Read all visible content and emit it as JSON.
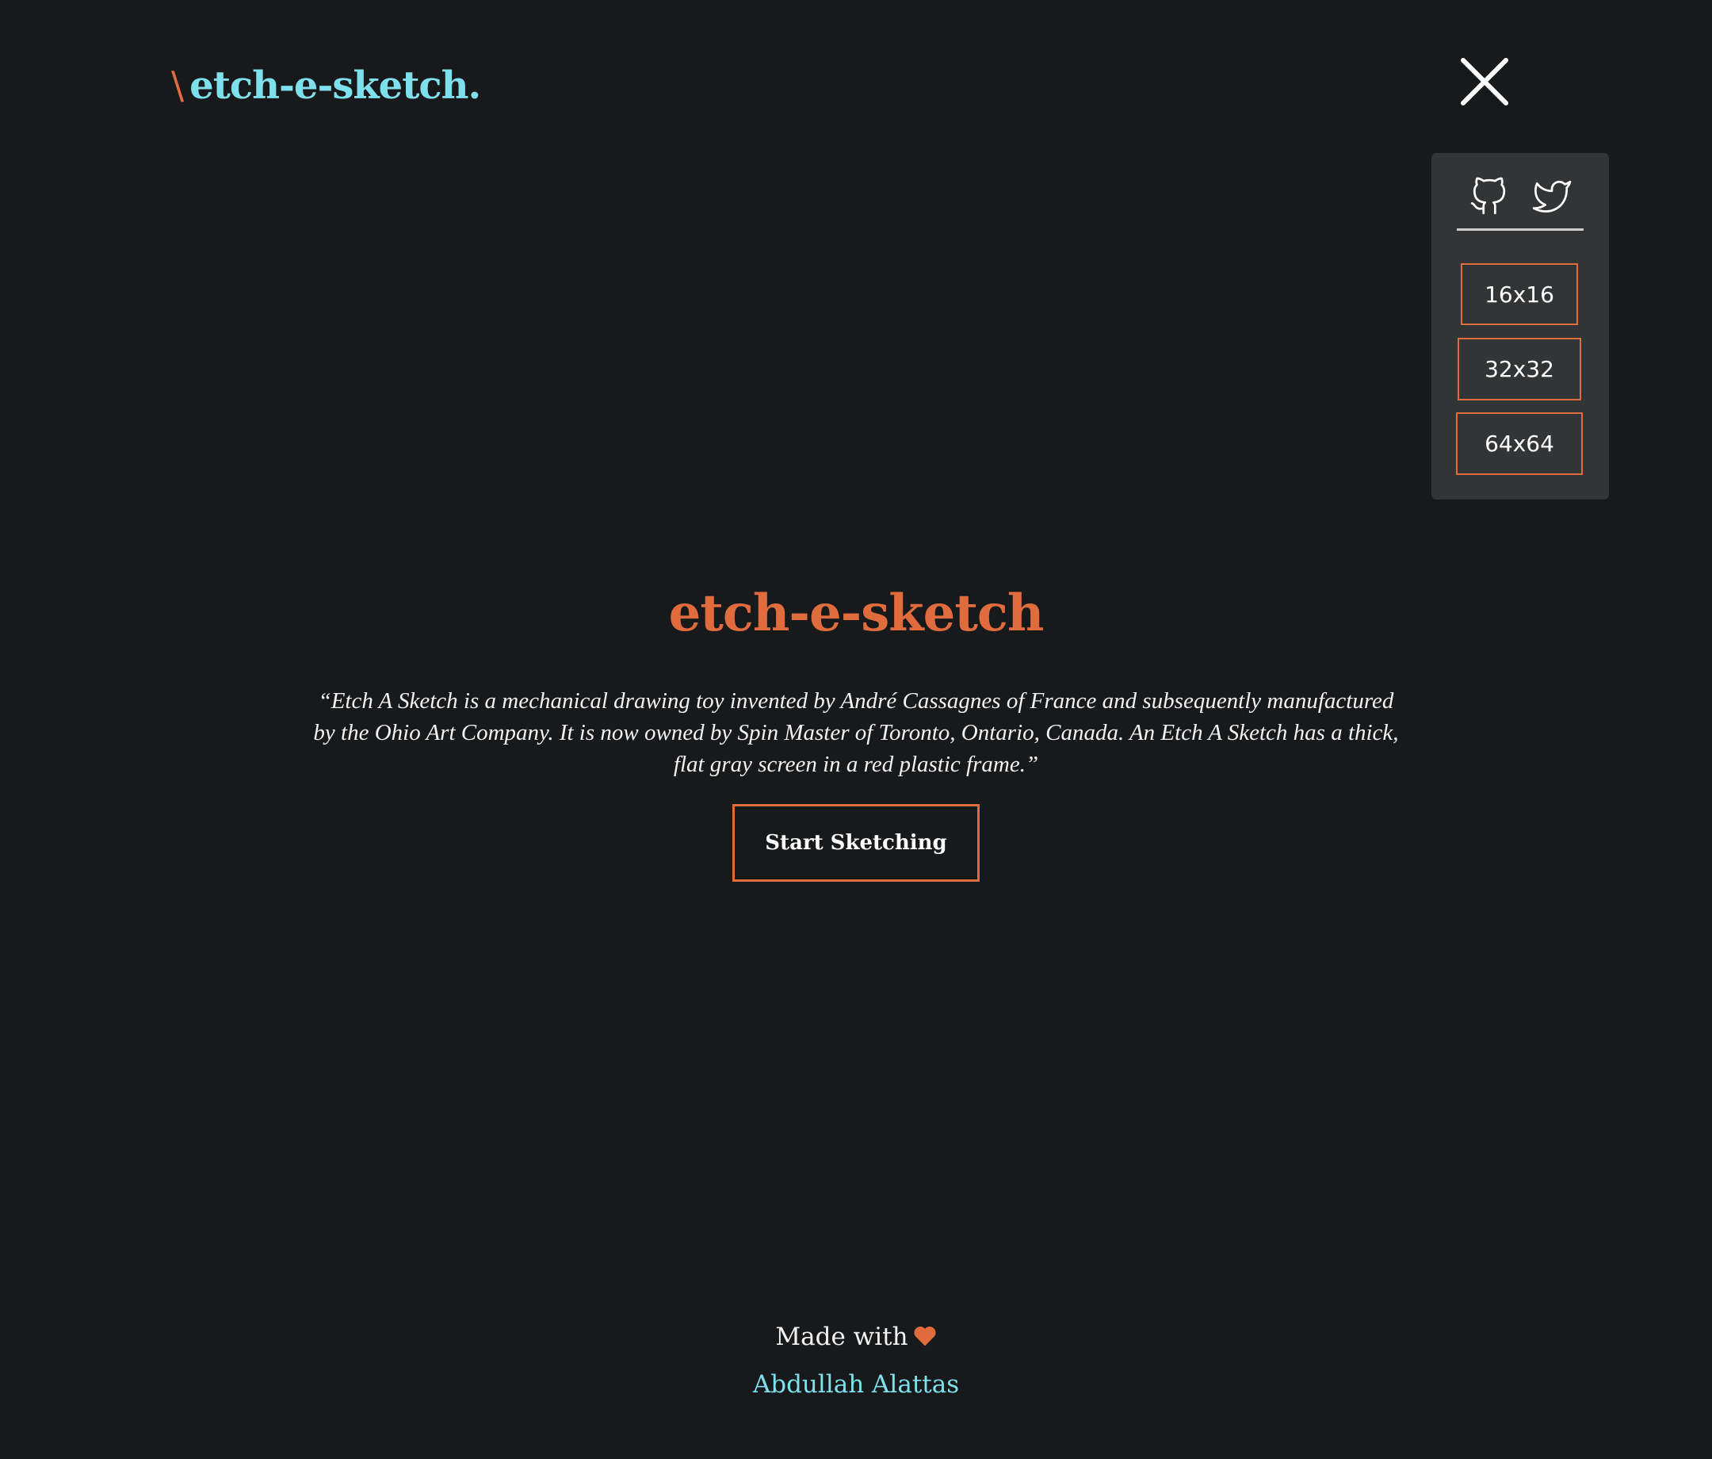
{
  "header": {
    "brand_slash": "\\",
    "brand_name": "etch-e-sketch."
  },
  "menu": {
    "close_icon": "close-icon",
    "social": [
      {
        "name": "GitHub",
        "icon": "github-icon"
      },
      {
        "name": "Twitter",
        "icon": "twitter-icon"
      }
    ],
    "grid_sizes": [
      "16x16",
      "32x32",
      "64x64"
    ]
  },
  "hero": {
    "title": "etch-e-sketch",
    "quote": "“Etch A Sketch is a mechanical drawing toy invented by André Cassagnes of France and subsequently manufactured by the Ohio Art Company. It is now owned by Spin Master of Toronto, Ontario, Canada. An Etch A Sketch has a thick, flat gray screen in a red plastic frame.”",
    "start_button": "Start Sketching"
  },
  "footer": {
    "made_with": "Made with",
    "heart_icon": "heart-icon",
    "author": "Abdullah Alattas"
  },
  "colors": {
    "background": "#18191b",
    "accent": "#e06c3e",
    "brand": "#7ee0ec",
    "panel": "#333435"
  }
}
